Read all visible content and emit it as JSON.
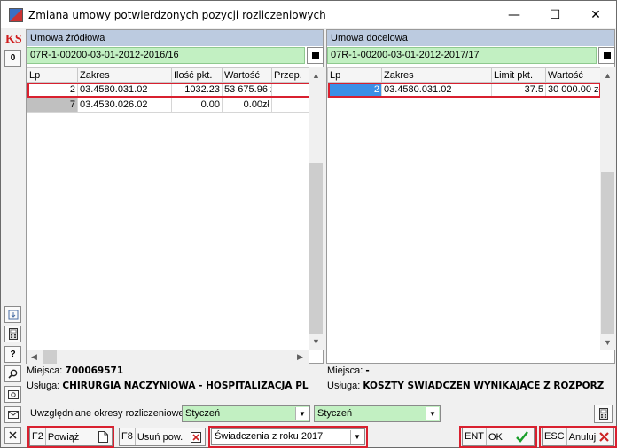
{
  "window": {
    "title": "Zmiana umowy potwierdzonych pozycji rozliczeniowych",
    "minimize": "—",
    "maximize": "☐",
    "close": "✕"
  },
  "leftbar": {
    "logo": "KS",
    "zero_button": "0",
    "help_button": "?"
  },
  "source": {
    "header": "Umowa źródłowa",
    "contract": "07R-1-00200-03-01-2012-2016/16",
    "columns": [
      "Lp",
      "Zakres",
      "Ilość pkt.",
      "Wartość",
      "Przep."
    ],
    "rows": [
      {
        "lp": "2",
        "zakres": "03.4580.031.02",
        "ilosc": "1032.23",
        "wartosc": "53 675.96 zł",
        "przep": ""
      },
      {
        "lp": "7",
        "zakres": "03.4530.026.02",
        "ilosc": "0.00",
        "wartosc": "0.00zł",
        "przep": ""
      }
    ],
    "miejsca_label": "Miejsca:",
    "miejsca_value": "700069571",
    "usluga_label": "Usługa:",
    "usluga_value": "CHIRURGIA NACZYNIOWA -  HOSPITALIZACJA PL"
  },
  "target": {
    "header": "Umowa docelowa",
    "contract": "07R-1-00200-03-01-2012-2017/17",
    "columns": [
      "Lp",
      "Zakres",
      "Limit pkt.",
      "Wartość"
    ],
    "rows": [
      {
        "lp": "2",
        "zakres": "03.4580.031.02",
        "limit": "37.5",
        "wartosc": "30 000.00 zł"
      }
    ],
    "miejsca_label": "Miejsca:",
    "miejsca_value": "-",
    "usluga_label": "Usługa:",
    "usluga_value": "KOSZTY ŚWIADCZEŃ WYNIKAJĄCE Z ROZPORZ"
  },
  "periods": {
    "label": "Uwzględniane okresy rozliczeniowe:",
    "from": "Styczeń",
    "to": "Styczeń"
  },
  "footer": {
    "link_key": "F2",
    "link_label": "Powiąż",
    "remove_key": "F8",
    "remove_label": "Usuń pow.",
    "year_select": "Świadczenia z roku 2017",
    "ok_key": "ENT",
    "ok_label": "OK",
    "cancel_key": "ESC",
    "cancel_label": "Anuluj"
  },
  "colors": {
    "accent_red": "#d9202f",
    "contract_green": "#c2f0c2",
    "header_blue": "#bccbe0",
    "selected_cell_blue": "#3b8fe6"
  }
}
